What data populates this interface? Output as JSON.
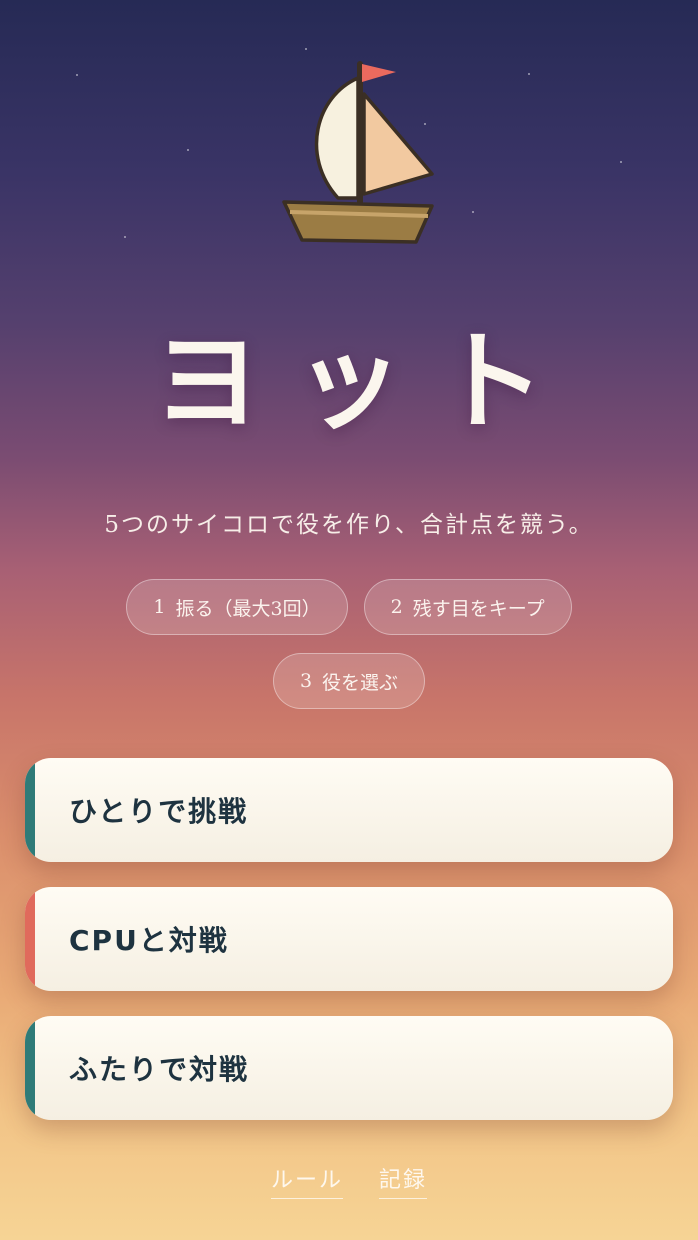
{
  "app": {
    "title": "ヨット",
    "subtitle": "5つのサイコロで役を作り、合計点を競う。"
  },
  "steps": [
    {
      "num": "1",
      "label": "振る（最大3回）"
    },
    {
      "num": "2",
      "label": "残す目をキープ"
    },
    {
      "num": "3",
      "label": "役を選ぶ"
    }
  ],
  "menu": {
    "solo": {
      "label": "ひとりで挑戦",
      "accent": "#2f7b78"
    },
    "cpu": {
      "label": "CPUと対戦",
      "accent": "#e06a5c"
    },
    "versus": {
      "label": "ふたりで対戦",
      "accent": "#2f7b78"
    }
  },
  "footer": {
    "rules": "ルール",
    "records": "記録"
  },
  "icons": {
    "logo": "sailboat-icon"
  }
}
